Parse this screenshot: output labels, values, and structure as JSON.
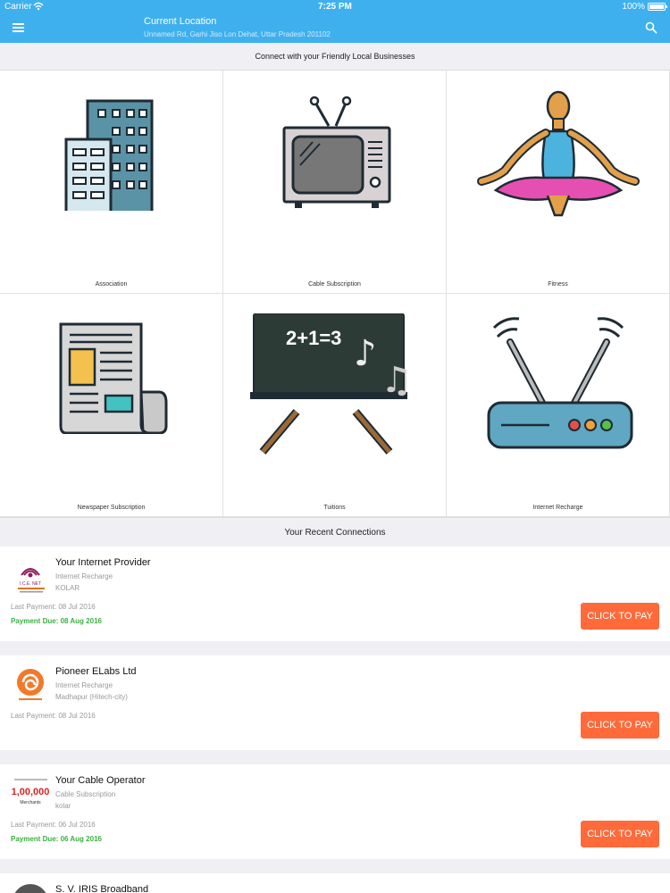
{
  "status_bar": {
    "carrier": "Carrier",
    "time": "7:25 PM",
    "battery": "100%"
  },
  "header": {
    "title": "Current Location",
    "subtitle": "Unnamed Rd, Garhi Jiso Lon Dehat, Uttar Pradesh 201102"
  },
  "categories_heading": "Connect with your Friendly Local Businesses",
  "categories": [
    {
      "label": "Association",
      "icon": "building-icon"
    },
    {
      "label": "Cable Subscription",
      "icon": "tv-icon"
    },
    {
      "label": "Fitness",
      "icon": "yoga-icon"
    },
    {
      "label": "Newspaper Subscription",
      "icon": "newspaper-icon"
    },
    {
      "label": "Tuitions",
      "icon": "chalkboard-icon"
    },
    {
      "label": "Internet Recharge",
      "icon": "router-icon"
    }
  ],
  "recent_heading": "Your Recent Connections",
  "connections": [
    {
      "name": "Your Internet Provider",
      "category": "Internet Recharge",
      "location": "KOLAR",
      "last_payment": "Last Payment: 08 Jul 2016",
      "due": "Payment Due: 08 Aug 2016",
      "pay_label": "CLICK TO PAY",
      "logo": "ice-net-logo"
    },
    {
      "name": "Pioneer ELabs Ltd",
      "category": "Internet Recharge",
      "location": "Madhapur (Hitech-city)",
      "last_payment": "Last Payment: 08 Jul 2016",
      "due": "",
      "pay_label": "CLICK TO PAY",
      "logo": "pioneer-logo"
    },
    {
      "name": "Your Cable Operator",
      "category": "Cable Subscription",
      "location": "kolar",
      "last_payment": "Last Payment: 06 Jul 2016",
      "due": "Payment Due: 06 Aug 2016",
      "pay_label": "CLICK TO PAY",
      "logo": "merchants-logo"
    },
    {
      "name": "S. V. IRIS Broadband",
      "logo": "iris-logo"
    }
  ],
  "logo_text": {
    "ice_net": "I.C.E. NET",
    "merchants_big": "1,00,000",
    "merchants_small": "Merchants"
  },
  "colors": {
    "primary": "#3fb0ee",
    "pay_button": "#ff6a3b",
    "due_text": "#3cb043"
  }
}
